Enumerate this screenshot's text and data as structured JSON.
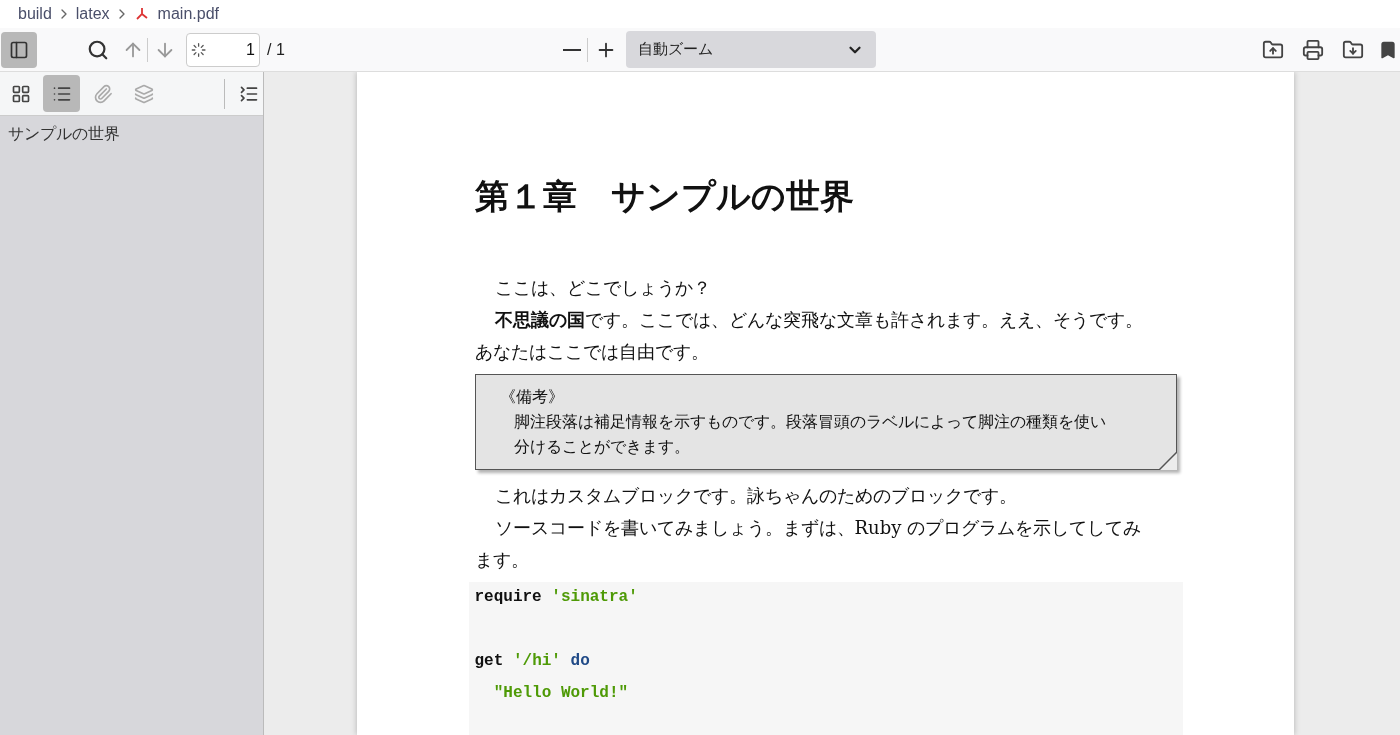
{
  "breadcrumb": [
    {
      "label": "build",
      "kind": "folder"
    },
    {
      "label": "latex",
      "kind": "folder"
    },
    {
      "label": "main.pdf",
      "kind": "pdf"
    }
  ],
  "toolbar": {
    "sidebar_toggle": {
      "selected": true
    },
    "page_input": {
      "value": "1"
    },
    "page_total": "/ 1",
    "zoom_select": {
      "value": "自動ズーム"
    }
  },
  "sidebar": {
    "view_buttons": [
      {
        "kind": "thumbnails",
        "selected": false
      },
      {
        "kind": "outline",
        "selected": true
      },
      {
        "kind": "attachments",
        "selected": false
      },
      {
        "kind": "layers",
        "selected": false
      }
    ],
    "outline": [
      {
        "label": "サンプルの世界"
      }
    ]
  },
  "document": {
    "title": "第１章　サンプルの世界",
    "paragraphs": [
      {
        "lines": [
          "ここは、どこでしょうか？"
        ]
      },
      {
        "lines": [
          "**不思議の国**です。ここでは、どんな突飛な文章も許されます。ええ、そうです。",
          "あなたはここでは自由です。"
        ]
      }
    ],
    "note": {
      "label": "《備考》",
      "lines": [
        "脚注段落は補足情報を示すものです。段落冒頭のラベルによって脚注の種類を使い",
        "分けることができます。"
      ]
    },
    "paragraphs_after": [
      {
        "lines": [
          "これはカスタムブロックです。詠ちゃんのためのブロックです。"
        ]
      },
      {
        "lines": [
          "ソースコードを書いてみましょう。まずは、Ruby のプログラムを示してしてみ",
          "ます。"
        ]
      }
    ],
    "code_groups": [
      [
        [
          {
            "kind": "plain",
            "text": "require"
          },
          {
            "kind": "string",
            "text": "'sinatra'"
          }
        ]
      ],
      [
        [
          {
            "kind": "plain",
            "text": "get"
          },
          {
            "kind": "string",
            "text": "'/hi'"
          },
          {
            "kind": "keyword",
            "text": "do"
          }
        ],
        [
          {
            "kind": "string",
            "text": "  \"Hello World!\""
          }
        ]
      ]
    ]
  }
}
